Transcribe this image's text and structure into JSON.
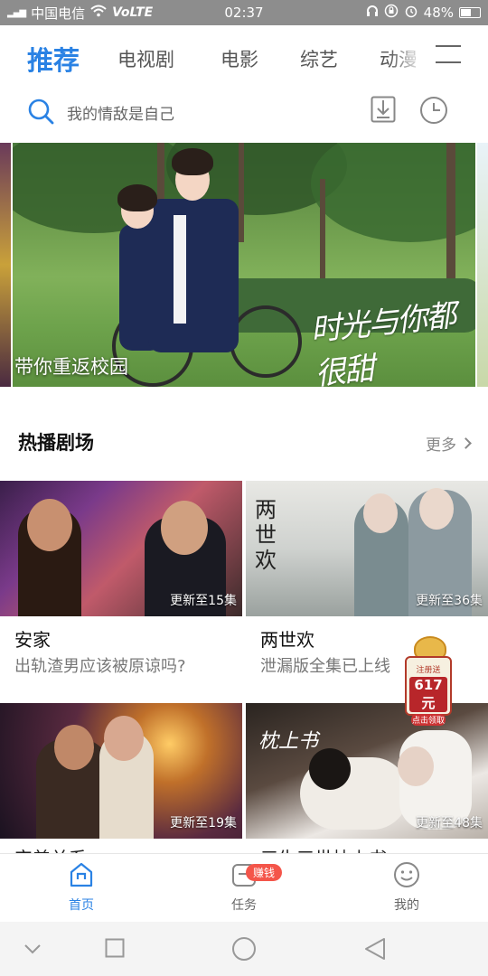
{
  "status_bar": {
    "carrier": "中国电信",
    "network": "VoLTE",
    "time": "02:37",
    "battery": "48%",
    "battery_level": 0.48
  },
  "tabs": [
    {
      "label": "推荐",
      "active": true
    },
    {
      "label": "电视剧",
      "active": false
    },
    {
      "label": "电影",
      "active": false
    },
    {
      "label": "综艺",
      "active": false
    },
    {
      "label": "动漫",
      "active": false
    }
  ],
  "search": {
    "placeholder": "我的情敌是自己"
  },
  "banner": {
    "caption": "带你重返校园",
    "logo_text": "时光与你都很甜"
  },
  "section": {
    "title": "热播剧场",
    "more": "更多"
  },
  "cards": [
    {
      "title": "安家",
      "subtitle": "出轨渣男应该被原谅吗?",
      "update": "更新至15集"
    },
    {
      "title": "两世欢",
      "subtitle": "泄漏版全集已上线",
      "update": "更新至36集",
      "poster_text": "两世欢"
    },
    {
      "title": "完美关系",
      "subtitle": "",
      "update": "更新至19集"
    },
    {
      "title": "三生三世枕上书",
      "subtitle": "",
      "update": "更新至48集",
      "poster_text": "枕上书"
    }
  ],
  "promo": {
    "line1": "注册送",
    "amount": "617元",
    "cta": "点击领取"
  },
  "bottom_nav": [
    {
      "label": "首页",
      "icon": "home-icon",
      "active": true
    },
    {
      "label": "任务",
      "icon": "task-icon",
      "active": false,
      "badge": "赚钱"
    },
    {
      "label": "我的",
      "icon": "profile-icon",
      "active": false
    }
  ],
  "colors": {
    "accent": "#2a82e4",
    "badge": "#f4554a",
    "status_bar": "#8d8d8d"
  }
}
